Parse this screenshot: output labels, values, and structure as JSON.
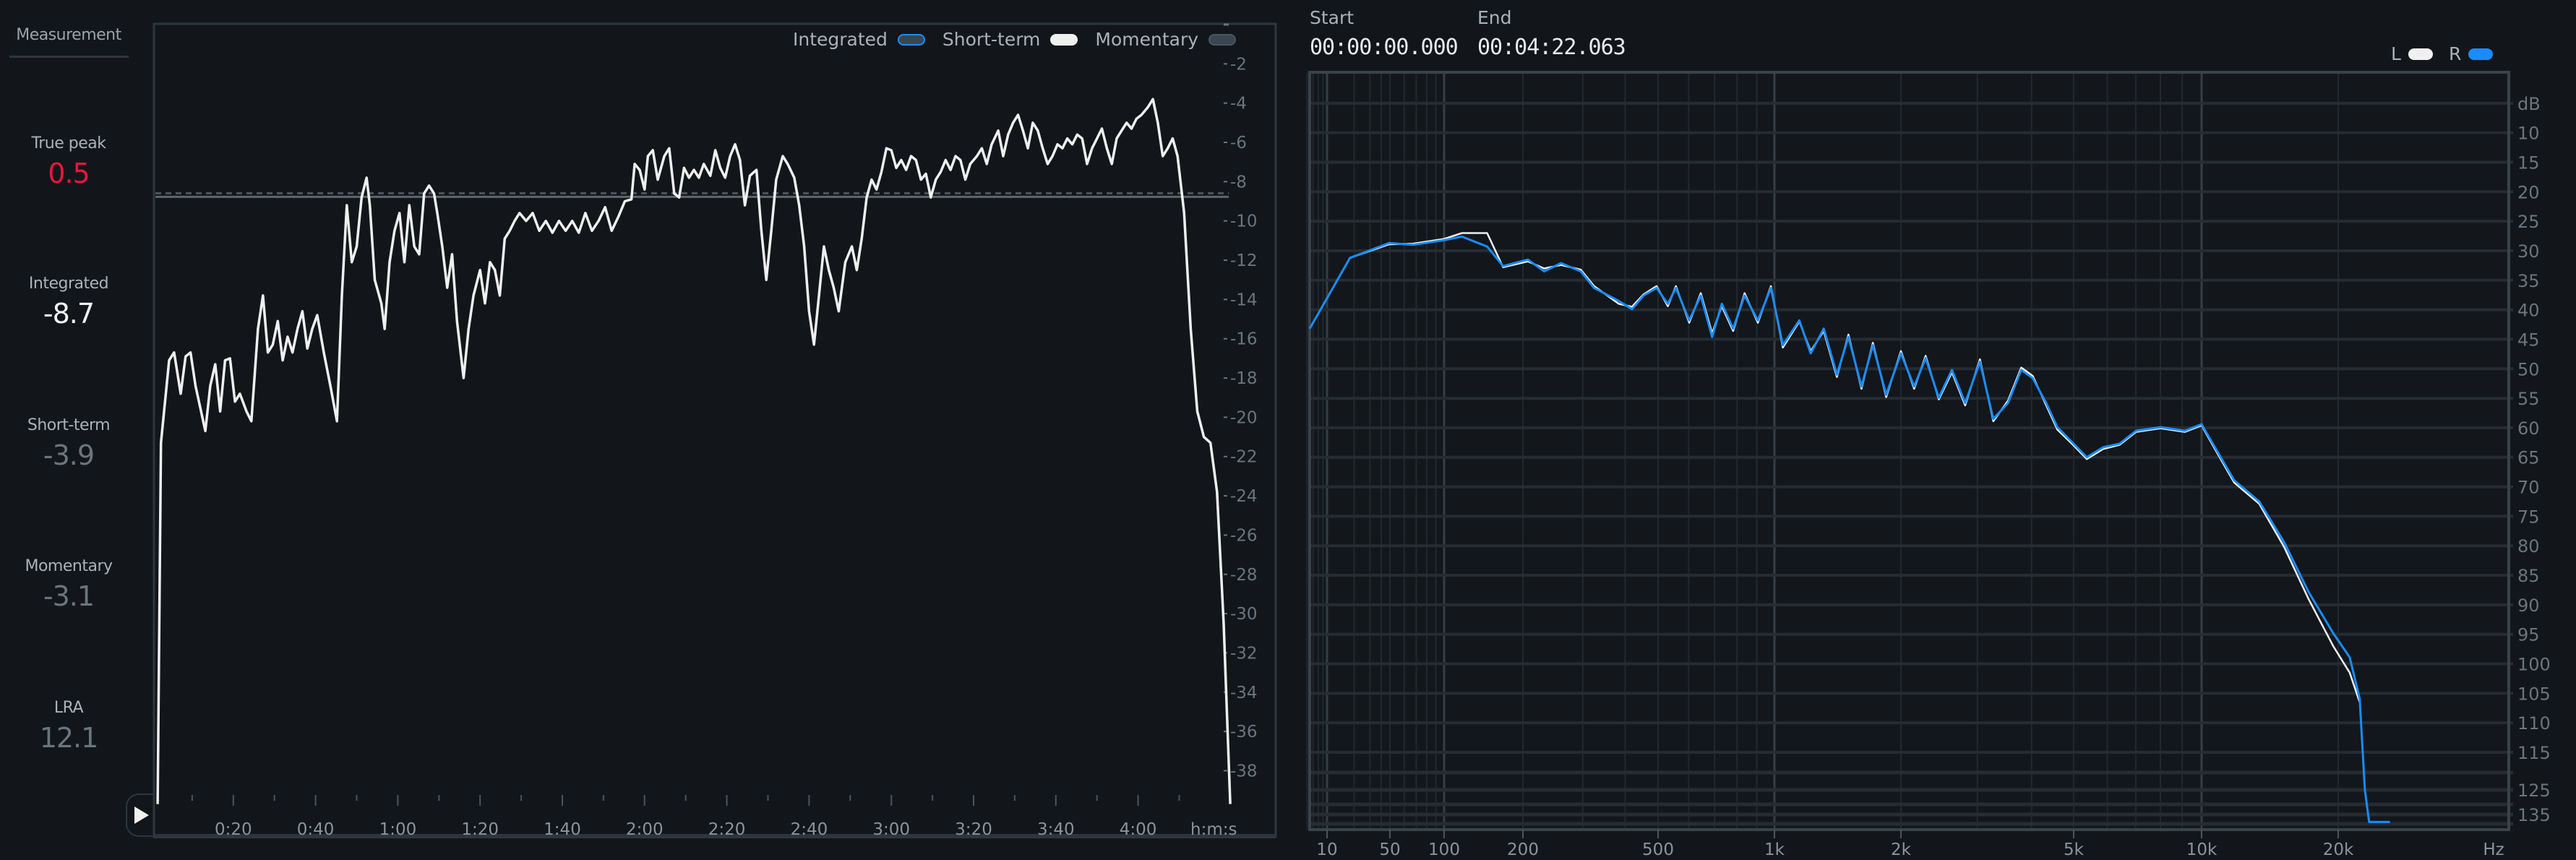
{
  "measurement": {
    "title": "Measurement",
    "items": [
      {
        "label": "True peak",
        "value": "0.5",
        "color": "#e8173a"
      },
      {
        "label": "Integrated",
        "value": "-8.7",
        "color": "#f2f4f5"
      },
      {
        "label": "Short-term",
        "value": "-3.9",
        "color": "#6b757d"
      },
      {
        "label": "Momentary",
        "value": "-3.1",
        "color": "#6b757d"
      },
      {
        "label": "LRA",
        "value": "12.1",
        "color": "#6b757d"
      }
    ]
  },
  "playback": {
    "play_icon": "play-icon"
  },
  "range": {
    "start_label": "Start",
    "start_value": "00:00:00.000",
    "end_label": "End",
    "end_value": "00:04:22.063"
  },
  "colors": {
    "background": "#12161a",
    "white": "#f0f0f0",
    "blue": "#1a8cff",
    "grid": "#23292e",
    "frame": "#2e363d",
    "red": "#e8173a"
  },
  "chart_data": [
    {
      "type": "line",
      "title": "",
      "legend": {
        "placement": "top-right",
        "entries": [
          {
            "name": "Integrated",
            "color": "#3a4650",
            "outline": "#1a8cff"
          },
          {
            "name": "Short-term",
            "color": "#f0f0f0"
          },
          {
            "name": "Momentary",
            "color": "#3a4650"
          }
        ]
      },
      "xlabel": "h:m:s",
      "xlim": [
        0,
        262
      ],
      "ylim": [
        0,
        -40
      ],
      "x_tick_labels": [
        "0:20",
        "0:40",
        "1:00",
        "1:20",
        "1:40",
        "2:00",
        "2:20",
        "2:40",
        "3:00",
        "3:20",
        "3:40",
        "4:00"
      ],
      "x_tick_values": [
        20,
        40,
        60,
        80,
        100,
        120,
        140,
        160,
        180,
        200,
        220,
        240
      ],
      "y_ticks": [
        -2,
        -4,
        -6,
        -8,
        -10,
        -12,
        -14,
        -16,
        -18,
        -20,
        -22,
        -24,
        -26,
        -28,
        -30,
        -32,
        -34,
        -36,
        -38
      ],
      "integrated_value": -8.7,
      "series": [
        {
          "name": "Short-term",
          "t": [
            1.6,
            2.4,
            4.4,
            5.6,
            7.2,
            8.4,
            9.6,
            10.8,
            13.2,
            14.4,
            15.6,
            16.8,
            18,
            19.2,
            20.4,
            21.6,
            23.2,
            24.4,
            26,
            27.2,
            28.4,
            29.6,
            30.8,
            32,
            33.2,
            34.4,
            35.6,
            36.8,
            38,
            39.2,
            40.4,
            42,
            43.6,
            45.2,
            46.4,
            47.6,
            48.8,
            50,
            51.2,
            52.4,
            53.2,
            54.4,
            56,
            56.8,
            58,
            59.2,
            60.4,
            61.6,
            62.8,
            64,
            65.2,
            66.4,
            67.6,
            68.8,
            69.6,
            70.8,
            72,
            73.2,
            74.4,
            76,
            77.2,
            78.4,
            80,
            81.2,
            82.4,
            83.6,
            84.8,
            86,
            87.2,
            88.4,
            89.6,
            91.2,
            92.8,
            94.4,
            96,
            97.6,
            99.2,
            100.8,
            102.4,
            104,
            105.6,
            107.2,
            108.8,
            110.4,
            112,
            113.6,
            115.2,
            116.8,
            117.6,
            118.8,
            120,
            120.8,
            122,
            123.2,
            124.8,
            126,
            127.2,
            128.4,
            129.6,
            130.8,
            132,
            133.2,
            134.4,
            136,
            137.2,
            138.4,
            139.6,
            140.8,
            142,
            143.2,
            144.4,
            145.6,
            147.2,
            148.4,
            149.6,
            150.8,
            152,
            153.6,
            154.8,
            156.4,
            157.6,
            158.8,
            160,
            161.2,
            162.4,
            163.6,
            164.8,
            166,
            167.2,
            168.8,
            170.4,
            171.6,
            172.8,
            174,
            175.2,
            176.4,
            177.6,
            178.8,
            180,
            181.2,
            182.4,
            183.6,
            184.8,
            186,
            187.2,
            188.4,
            189.6,
            190.8,
            192,
            193.2,
            194.4,
            195.6,
            196.8,
            198,
            199.2,
            200.8,
            202,
            203.2,
            204.4,
            206,
            207.2,
            208.4,
            209.6,
            210.8,
            212,
            213.2,
            214.4,
            215.6,
            216.8,
            218,
            219.2,
            220.4,
            221.6,
            222.8,
            224,
            225.2,
            226.4,
            227.6,
            228.8,
            230,
            231.2,
            232.4,
            233.6,
            234.8,
            236,
            237.2,
            238.4,
            239.6,
            240.8,
            242.4,
            243.6,
            244.8,
            246,
            247.2,
            248.4,
            249.6,
            251.2,
            252.8,
            254.4,
            256,
            257.6,
            259.2,
            260.8,
            262.4
          ],
          "lufs": [
            -39.7,
            -21.3,
            -17.1,
            -16.7,
            -18.8,
            -16.9,
            -16.7,
            -18.4,
            -20.7,
            -18.4,
            -17.3,
            -19.7,
            -17.1,
            -17.0,
            -19.2,
            -18.8,
            -19.7,
            -20.2,
            -15.5,
            -13.8,
            -16.7,
            -16.3,
            -15.1,
            -17.1,
            -15.9,
            -16.7,
            -15.5,
            -14.6,
            -16.5,
            -15.5,
            -14.8,
            -16.7,
            -18.4,
            -20.2,
            -13.8,
            -9.2,
            -12.1,
            -11.3,
            -8.8,
            -7.8,
            -9.2,
            -13.0,
            -14.2,
            -15.5,
            -12.1,
            -10.5,
            -9.6,
            -12.1,
            -9.2,
            -11.3,
            -11.7,
            -8.6,
            -8.2,
            -8.6,
            -9.6,
            -11.3,
            -13.4,
            -11.7,
            -15.1,
            -18.0,
            -15.5,
            -13.8,
            -12.5,
            -14.2,
            -12.1,
            -12.5,
            -13.8,
            -10.9,
            -10.5,
            -10.0,
            -9.6,
            -10.0,
            -9.6,
            -10.5,
            -10.0,
            -10.6,
            -10.0,
            -10.5,
            -10.0,
            -10.6,
            -9.6,
            -10.5,
            -10.0,
            -9.3,
            -10.5,
            -9.8,
            -9.0,
            -8.9,
            -7.1,
            -7.4,
            -8.4,
            -6.7,
            -6.4,
            -7.9,
            -6.7,
            -6.3,
            -8.6,
            -8.8,
            -7.3,
            -7.8,
            -7.4,
            -7.8,
            -7.1,
            -7.7,
            -6.4,
            -7.3,
            -7.8,
            -6.7,
            -6.1,
            -6.9,
            -9.2,
            -7.7,
            -7.4,
            -10.5,
            -13.0,
            -10.5,
            -7.9,
            -6.7,
            -7.1,
            -7.8,
            -9.2,
            -11.3,
            -14.6,
            -16.3,
            -13.8,
            -11.3,
            -12.5,
            -13.4,
            -14.6,
            -12.1,
            -11.3,
            -12.5,
            -10.9,
            -8.8,
            -7.9,
            -8.4,
            -7.5,
            -6.3,
            -6.4,
            -7.3,
            -6.9,
            -7.4,
            -6.7,
            -6.9,
            -7.9,
            -7.6,
            -8.8,
            -7.9,
            -7.5,
            -6.9,
            -7.4,
            -6.7,
            -6.9,
            -7.9,
            -7.1,
            -6.7,
            -6.3,
            -7.1,
            -6.1,
            -5.4,
            -6.7,
            -5.6,
            -5.0,
            -4.6,
            -5.4,
            -6.3,
            -5.0,
            -5.4,
            -6.3,
            -7.1,
            -6.7,
            -6.1,
            -6.3,
            -5.8,
            -6.1,
            -5.6,
            -5.8,
            -7.1,
            -6.3,
            -5.8,
            -5.3,
            -6.3,
            -7.1,
            -5.8,
            -5.4,
            -5.0,
            -5.3,
            -4.8,
            -4.6,
            -4.2,
            -3.8,
            -5.0,
            -6.7,
            -6.3,
            -5.8,
            -6.7,
            -9.6,
            -15.5,
            -19.7,
            -21.0,
            -21.3,
            -23.8,
            -30.5,
            -39.7
          ]
        }
      ]
    },
    {
      "type": "line",
      "title": "",
      "xscale": "log",
      "xlabel": "Hz",
      "ylabel": "dB",
      "ylim": [
        0,
        140
      ],
      "x_tick_labels": [
        "10",
        "50",
        "100",
        "200",
        "500",
        "1k",
        "2k",
        "5k",
        "10k",
        "20k"
      ],
      "x_tick_values": [
        10,
        50,
        100,
        200,
        500,
        1000,
        2000,
        5000,
        10000,
        20000
      ],
      "y_tick_labels": [
        "dB",
        "10",
        "15",
        "20",
        "25",
        "30",
        "35",
        "40",
        "45",
        "50",
        "55",
        "60",
        "65",
        "70",
        "75",
        "80",
        "85",
        "90",
        "95",
        "100",
        "105",
        "110",
        "115",
        "125",
        "135"
      ],
      "y_tick_values": [
        5,
        10,
        15,
        20,
        25,
        30,
        35,
        40,
        45,
        50,
        55,
        60,
        65,
        70,
        75,
        80,
        85,
        90,
        95,
        100,
        105,
        110,
        115,
        125,
        135
      ],
      "legend": {
        "placement": "top-right",
        "entries": [
          {
            "name": "L",
            "color": "#f0f0f0"
          },
          {
            "name": "R",
            "color": "#1a8cff"
          }
        ]
      },
      "series": [
        {
          "name": "L",
          "color": "#f0f0f0",
          "hz": [
            18,
            49,
            67,
            100,
            117,
            146,
            168,
            207,
            231,
            259,
            296,
            324,
            383,
            419,
            453,
            495,
            530,
            556,
            602,
            645,
            690,
            731,
            782,
            837,
            906,
            979,
            1047,
            1146,
            1220,
            1310,
            1408,
            1500,
            1611,
            1715,
            1845,
            2000,
            2145,
            2280,
            2445,
            2622,
            2812,
            3041,
            3264,
            3530,
            3786,
            4025,
            4322,
            4585,
            5000,
            5370,
            5866,
            6410,
            7010,
            8000,
            9140,
            10000,
            10700,
            11800,
            13400,
            15200,
            17200,
            19500,
            21200,
            22300
          ],
          "db": [
            31.2,
            28.9,
            28.8,
            28.0,
            27.0,
            27.0,
            32.8,
            31.8,
            33.0,
            32.4,
            33.2,
            36.0,
            39.0,
            39.5,
            37.4,
            36.0,
            39.4,
            36.0,
            42.2,
            37.2,
            44.0,
            39.4,
            43.6,
            37.2,
            42.2,
            36.0,
            46.4,
            42.0,
            47.0,
            43.6,
            51.4,
            44.2,
            53.4,
            45.6,
            54.8,
            47.0,
            53.4,
            47.8,
            55.2,
            50.6,
            56.2,
            48.4,
            58.9,
            55.4,
            49.8,
            51.2,
            56.2,
            60.3,
            63.0,
            65.3,
            63.6,
            62.9,
            60.7,
            60.1,
            60.7,
            59.6,
            63.6,
            69.3,
            72.9,
            80.2,
            89.0,
            97.0,
            101.5,
            106.5
          ]
        },
        {
          "name": "R",
          "color": "#1a8cff",
          "hz": [
            6.3,
            18,
            49,
            67,
            100,
            117,
            146,
            168,
            207,
            231,
            259,
            296,
            324,
            383,
            419,
            453,
            495,
            530,
            556,
            602,
            645,
            690,
            731,
            782,
            837,
            906,
            979,
            1047,
            1146,
            1220,
            1310,
            1408,
            1500,
            1611,
            1715,
            1845,
            2000,
            2145,
            2280,
            2445,
            2622,
            2812,
            3041,
            3264,
            3530,
            3786,
            4025,
            4322,
            4585,
            5000,
            5370,
            5866,
            6410,
            7010,
            8000,
            9140,
            10000,
            10700,
            11800,
            13400,
            15200,
            17200,
            19500,
            21200,
            22300,
            22900,
            23400,
            26000
          ],
          "db": [
            43.2,
            31.2,
            28.7,
            29.0,
            28.2,
            27.6,
            29.3,
            32.6,
            31.5,
            33.5,
            32.1,
            33.5,
            36.3,
            38.5,
            39.9,
            37.6,
            36.3,
            39.0,
            36.3,
            41.8,
            37.6,
            44.6,
            39.0,
            43.2,
            37.6,
            41.8,
            36.3,
            46.0,
            41.8,
            47.4,
            43.2,
            51.0,
            44.6,
            53.0,
            46.0,
            54.4,
            47.4,
            53.0,
            48.2,
            54.9,
            50.2,
            55.8,
            48.8,
            58.5,
            55.8,
            50.2,
            51.6,
            55.8,
            59.9,
            62.7,
            65.0,
            63.3,
            62.7,
            60.5,
            59.9,
            60.5,
            59.4,
            63.3,
            68.9,
            72.5,
            79.4,
            87.8,
            94.8,
            98.9,
            105.9,
            125,
            139,
            139
          ]
        }
      ]
    }
  ]
}
